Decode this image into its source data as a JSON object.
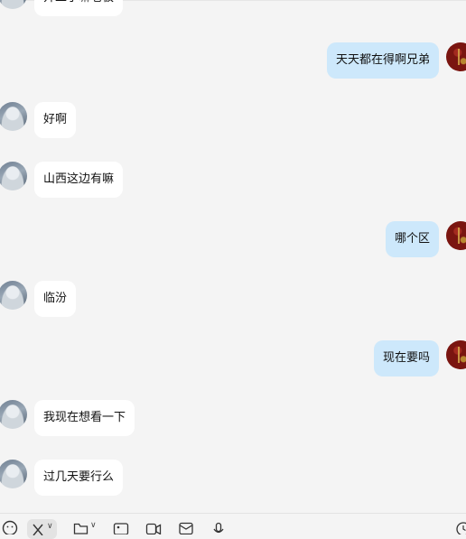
{
  "messages": [
    {
      "side": "left",
      "text": "开工了嘛老板"
    },
    {
      "side": "right",
      "text": "天天都在得啊兄弟"
    },
    {
      "side": "left",
      "text": "好啊"
    },
    {
      "side": "left",
      "text": "山西这边有嘛"
    },
    {
      "side": "right",
      "text": "哪个区"
    },
    {
      "side": "left",
      "text": "临汾"
    },
    {
      "side": "right",
      "text": "现在要吗"
    },
    {
      "side": "left",
      "text": "我现在想看一下"
    },
    {
      "side": "left",
      "text": "过几天要行么"
    }
  ],
  "toolbar": {
    "icons": [
      "emoji-icon",
      "scissors-icon",
      "folder-icon",
      "image-icon",
      "video-call-icon",
      "red-packet-icon",
      "microphone-icon",
      "history-icon"
    ]
  },
  "colors": {
    "background": "#f4f4f4",
    "incoming_bubble": "#ffffff",
    "outgoing_bubble": "#cde8fb"
  }
}
